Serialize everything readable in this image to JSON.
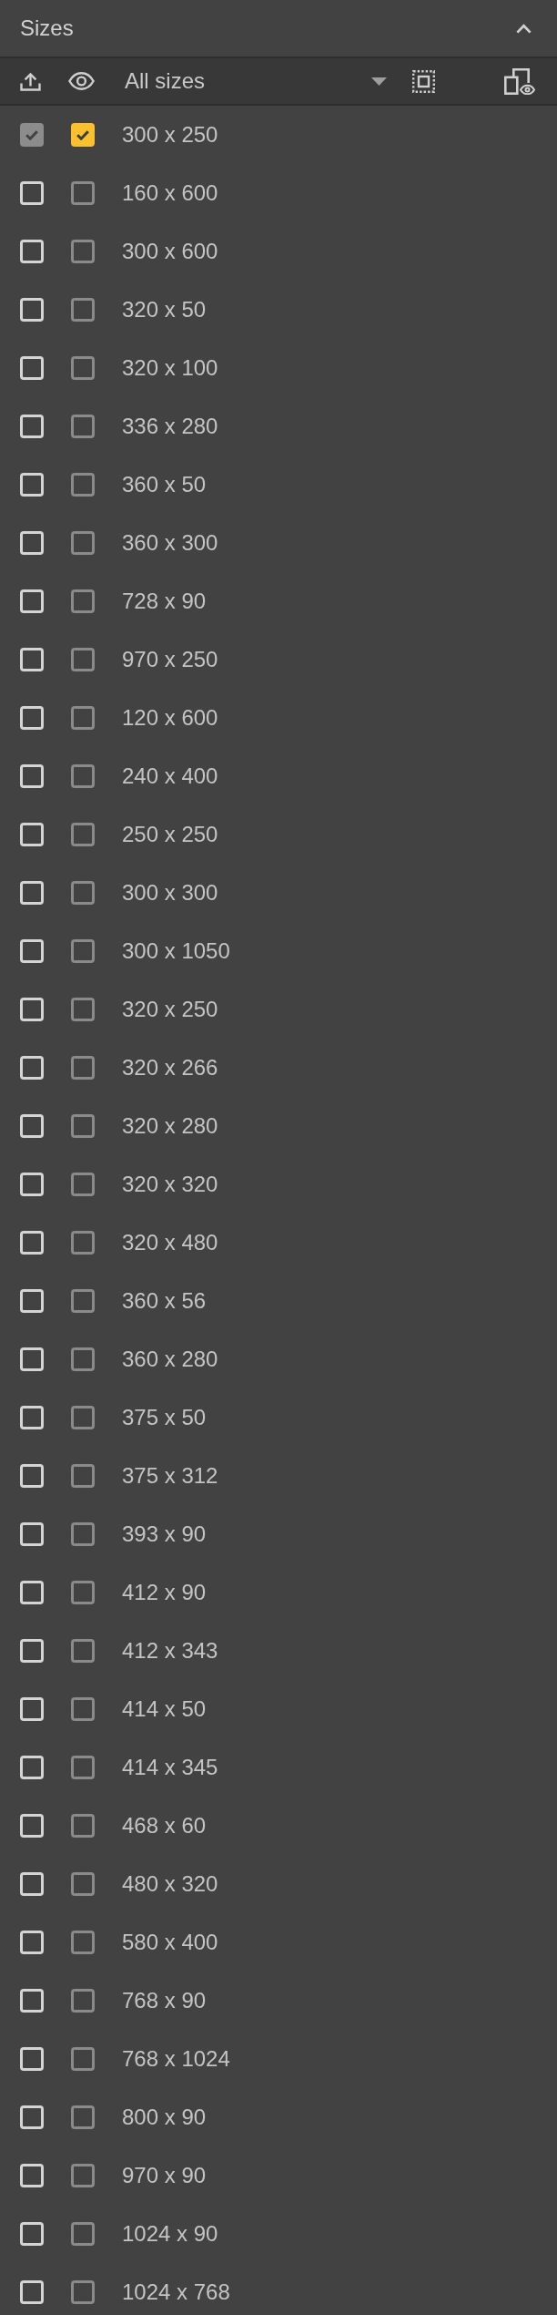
{
  "header": {
    "title": "Sizes",
    "expanded": true
  },
  "toolbar": {
    "filter": "All sizes"
  },
  "sizes": [
    {
      "label": "300 x 250",
      "export_checked": true,
      "export_disabled": true,
      "preview_checked": true
    },
    {
      "label": "160 x 600",
      "export_checked": false,
      "export_disabled": false,
      "preview_checked": false
    },
    {
      "label": "300 x 600",
      "export_checked": false,
      "export_disabled": false,
      "preview_checked": false
    },
    {
      "label": "320 x 50",
      "export_checked": false,
      "export_disabled": false,
      "preview_checked": false
    },
    {
      "label": "320 x 100",
      "export_checked": false,
      "export_disabled": false,
      "preview_checked": false
    },
    {
      "label": "336 x 280",
      "export_checked": false,
      "export_disabled": false,
      "preview_checked": false
    },
    {
      "label": "360 x 50",
      "export_checked": false,
      "export_disabled": false,
      "preview_checked": false
    },
    {
      "label": "360 x 300",
      "export_checked": false,
      "export_disabled": false,
      "preview_checked": false
    },
    {
      "label": "728 x 90",
      "export_checked": false,
      "export_disabled": false,
      "preview_checked": false
    },
    {
      "label": "970 x 250",
      "export_checked": false,
      "export_disabled": false,
      "preview_checked": false
    },
    {
      "label": "120 x 600",
      "export_checked": false,
      "export_disabled": false,
      "preview_checked": false
    },
    {
      "label": "240 x 400",
      "export_checked": false,
      "export_disabled": false,
      "preview_checked": false
    },
    {
      "label": "250 x 250",
      "export_checked": false,
      "export_disabled": false,
      "preview_checked": false
    },
    {
      "label": "300 x 300",
      "export_checked": false,
      "export_disabled": false,
      "preview_checked": false
    },
    {
      "label": "300 x 1050",
      "export_checked": false,
      "export_disabled": false,
      "preview_checked": false
    },
    {
      "label": "320 x 250",
      "export_checked": false,
      "export_disabled": false,
      "preview_checked": false
    },
    {
      "label": "320 x 266",
      "export_checked": false,
      "export_disabled": false,
      "preview_checked": false
    },
    {
      "label": "320 x 280",
      "export_checked": false,
      "export_disabled": false,
      "preview_checked": false
    },
    {
      "label": "320 x 320",
      "export_checked": false,
      "export_disabled": false,
      "preview_checked": false
    },
    {
      "label": "320 x 480",
      "export_checked": false,
      "export_disabled": false,
      "preview_checked": false
    },
    {
      "label": "360 x 56",
      "export_checked": false,
      "export_disabled": false,
      "preview_checked": false
    },
    {
      "label": "360 x 280",
      "export_checked": false,
      "export_disabled": false,
      "preview_checked": false
    },
    {
      "label": "375 x 50",
      "export_checked": false,
      "export_disabled": false,
      "preview_checked": false
    },
    {
      "label": "375 x 312",
      "export_checked": false,
      "export_disabled": false,
      "preview_checked": false
    },
    {
      "label": "393 x 90",
      "export_checked": false,
      "export_disabled": false,
      "preview_checked": false
    },
    {
      "label": "412 x 90",
      "export_checked": false,
      "export_disabled": false,
      "preview_checked": false
    },
    {
      "label": "412 x 343",
      "export_checked": false,
      "export_disabled": false,
      "preview_checked": false
    },
    {
      "label": "414 x 50",
      "export_checked": false,
      "export_disabled": false,
      "preview_checked": false
    },
    {
      "label": "414 x 345",
      "export_checked": false,
      "export_disabled": false,
      "preview_checked": false
    },
    {
      "label": "468 x 60",
      "export_checked": false,
      "export_disabled": false,
      "preview_checked": false
    },
    {
      "label": "480 x 320",
      "export_checked": false,
      "export_disabled": false,
      "preview_checked": false
    },
    {
      "label": "580 x 400",
      "export_checked": false,
      "export_disabled": false,
      "preview_checked": false
    },
    {
      "label": "768 x 90",
      "export_checked": false,
      "export_disabled": false,
      "preview_checked": false
    },
    {
      "label": "768 x 1024",
      "export_checked": false,
      "export_disabled": false,
      "preview_checked": false
    },
    {
      "label": "800 x 90",
      "export_checked": false,
      "export_disabled": false,
      "preview_checked": false
    },
    {
      "label": "970 x 90",
      "export_checked": false,
      "export_disabled": false,
      "preview_checked": false
    },
    {
      "label": "1024 x 90",
      "export_checked": false,
      "export_disabled": false,
      "preview_checked": false
    },
    {
      "label": "1024 x 768",
      "export_checked": false,
      "export_disabled": false,
      "preview_checked": false
    }
  ]
}
